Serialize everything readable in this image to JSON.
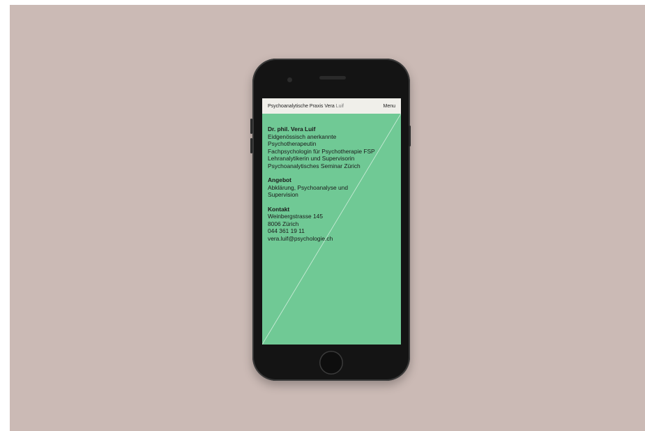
{
  "header": {
    "brand_main": "Psychoanalytische Praxis Vera",
    "brand_thin": "Luif",
    "menu_label": "Menu"
  },
  "profile": {
    "name": "Dr. phil. Vera Luif",
    "lines": [
      "Eidgenössisch anerkannte",
      "Psychotherapeutin",
      "Fachpsychologin für Psychotherapie FSP",
      "Lehranalytikerin und Supervisorin",
      "Psychoanalytisches Seminar Zürich"
    ]
  },
  "offer": {
    "heading": "Angebot",
    "lines": [
      "Abklärung, Psychoanalyse und",
      "Supervision"
    ]
  },
  "contact": {
    "heading": "Kontakt",
    "street": "Weinbergstrasse 145",
    "city": "8006 Zürich",
    "phone": "044 361 19 11",
    "email": "vera.luif@psychologie.ch"
  },
  "colors": {
    "background": "#cbbab5",
    "screen": "#70c995",
    "topbar": "#f0efea"
  }
}
